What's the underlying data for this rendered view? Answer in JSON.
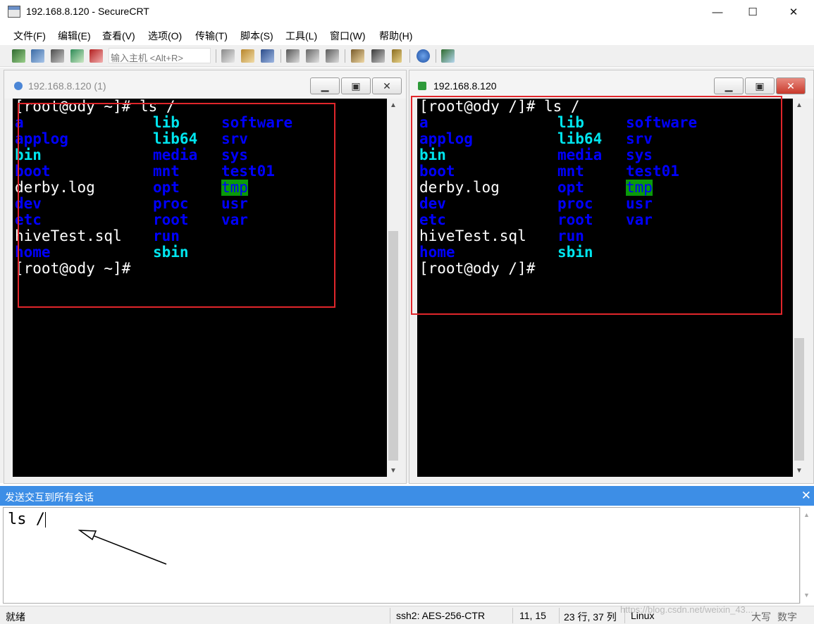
{
  "window": {
    "title": "192.168.8.120 - SecureCRT",
    "minimize_glyph": "—",
    "maximize_glyph": "☐",
    "close_glyph": "✕"
  },
  "menu": [
    "文件(F)",
    "编辑(E)",
    "查看(V)",
    "选项(O)",
    "传输(T)",
    "脚本(S)",
    "工具(L)",
    "窗口(W)",
    "帮助(H)"
  ],
  "toolbar": {
    "quick_connect_placeholder": "输入主机 <Alt+R>"
  },
  "left_pane": {
    "title": "192.168.8.120 (1)",
    "status_icon": "info-icon",
    "active": false
  },
  "right_pane": {
    "title": "192.168.8.120",
    "status_icon": "checkmark-icon",
    "active": true
  },
  "terminal": {
    "left_prompt": "[root@ody ~]# ls /",
    "left_end_prompt": "[root@ody ~]#",
    "right_prompt": "[root@ody /]# ls /",
    "right_end_prompt": "[root@ody /]#",
    "col1": [
      {
        "text": "a",
        "color": "blue"
      },
      {
        "text": "applog",
        "color": "blue"
      },
      {
        "text": "bin",
        "color": "cyan"
      },
      {
        "text": "boot",
        "color": "blue"
      },
      {
        "text": "derby.log",
        "color": "white"
      },
      {
        "text": "dev",
        "color": "blue"
      },
      {
        "text": "etc",
        "color": "blue"
      },
      {
        "text": "hiveTest.sql",
        "color": "white"
      },
      {
        "text": "home",
        "color": "blue"
      }
    ],
    "col2": [
      {
        "text": "lib",
        "color": "cyan"
      },
      {
        "text": "lib64",
        "color": "cyan"
      },
      {
        "text": "media",
        "color": "blue"
      },
      {
        "text": "mnt",
        "color": "blue"
      },
      {
        "text": "opt",
        "color": "blue"
      },
      {
        "text": "proc",
        "color": "blue"
      },
      {
        "text": "root",
        "color": "blue"
      },
      {
        "text": "run",
        "color": "blue"
      },
      {
        "text": "sbin",
        "color": "cyan"
      }
    ],
    "col3": [
      {
        "text": "software",
        "color": "blue"
      },
      {
        "text": "srv",
        "color": "blue"
      },
      {
        "text": "sys",
        "color": "blue"
      },
      {
        "text": "test01",
        "color": "blue"
      },
      {
        "text": "tmp",
        "color": "tmp"
      },
      {
        "text": "usr",
        "color": "blue"
      },
      {
        "text": "var",
        "color": "blue"
      }
    ],
    "colors": {
      "background": "#000000",
      "white": "#ffffff",
      "blue": "#0000ff",
      "cyan": "#00e5ee",
      "tmp_bg": "#0a9a0a"
    }
  },
  "send_bar": {
    "label": "发送交互到所有会话",
    "close_glyph": "✕",
    "input_value": "ls /",
    "accent": "#3d8ee6"
  },
  "statusbar": {
    "ready": "就绪",
    "cipher": "ssh2: AES-256-CTR",
    "cursor": "11, 15",
    "size": "23 行, 37 列",
    "os": "Linux",
    "caps": "大写",
    "num": "数字"
  },
  "watermark": "https://blog.csdn.net/weixin_43..."
}
